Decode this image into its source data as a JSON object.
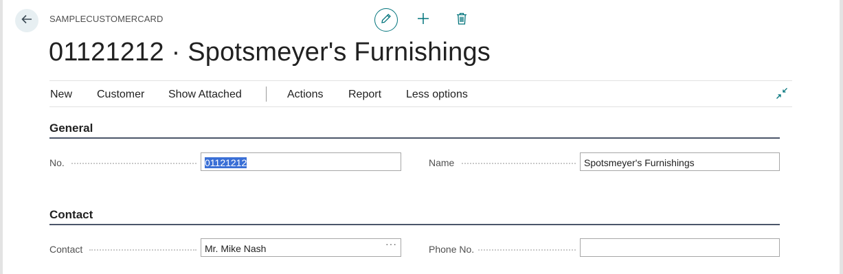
{
  "header": {
    "caption": "SAMPLECUSTOMERCARD",
    "title": "01121212 · Spotsmeyer's Furnishings",
    "icons": {
      "back": "arrow-left-icon",
      "edit": "pencil-icon",
      "add": "plus-icon",
      "delete": "trash-icon",
      "collapse": "collapse-icon"
    }
  },
  "actionbar": {
    "items": [
      "New",
      "Customer",
      "Show Attached",
      "Actions",
      "Report",
      "Less options"
    ]
  },
  "groups": {
    "general": {
      "title": "General",
      "no_label": "No.",
      "no_value": "01121212",
      "name_label": "Name",
      "name_value": "Spotsmeyer's Furnishings"
    },
    "contact": {
      "title": "Contact",
      "contact_label": "Contact",
      "contact_value": "Mr. Mike Nash",
      "contact_lookup": "···",
      "phone_label": "Phone No.",
      "phone_value": ""
    }
  },
  "colors": {
    "accent": "#00737b",
    "selection": "#3a6fd6",
    "group_rule": "#4b5569"
  }
}
